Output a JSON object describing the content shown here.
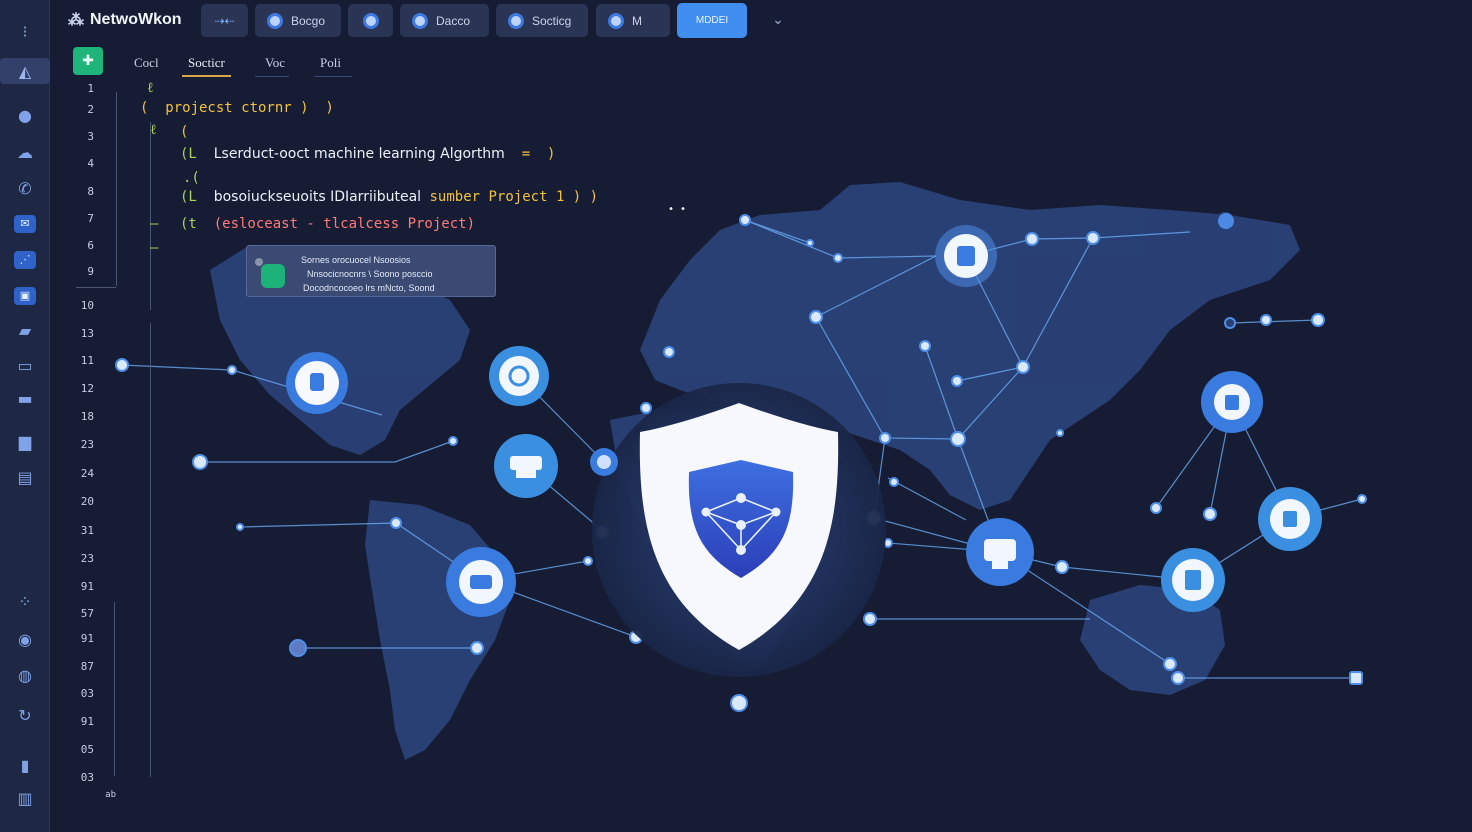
{
  "app": {
    "title": "NetwoWkon",
    "colors": {
      "background": "#161c33",
      "accent": "#3f8ef0",
      "run": "#1fb47a",
      "node": "#3a7be0"
    }
  },
  "toolbar": {
    "chips": [
      {
        "label": "",
        "icon": "arrows-icon"
      },
      {
        "label": "Bocgo",
        "icon": "circle-icon"
      },
      {
        "label": "",
        "icon": "circle-icon"
      },
      {
        "label": "Dacco",
        "icon": "circle-icon"
      },
      {
        "label": "Socticg",
        "icon": "circle-icon"
      },
      {
        "label": "M",
        "icon": "circle-icon"
      }
    ],
    "primary_label": "MDDEI",
    "more_icon": "chevron-down-icon"
  },
  "rail": {
    "icons": [
      "menu-icon",
      "mountain-icon",
      "circle-icon",
      "cloud-icon",
      "phone-icon",
      "mail-icon",
      "chart-icon",
      "square-icon",
      "chat-icon",
      "monitor-icon",
      "message-icon",
      "comment-icon",
      "id-card-icon",
      "dots-icon",
      "globe-icon",
      "compass-icon",
      "refresh-icon",
      "trash-icon",
      "bar-chart-icon"
    ]
  },
  "editor": {
    "run_icon": "play-icon",
    "tabs": [
      "Cocl",
      "Socticr",
      "Voc",
      "Poli"
    ],
    "active_tab": "Socticr",
    "line_numbers": [
      "1",
      "2",
      "3",
      "4",
      "8",
      "7",
      "6",
      "9",
      "10",
      "13",
      "11",
      "12",
      "18",
      "23",
      "24",
      "20",
      "31",
      "23",
      "91",
      "57",
      "91",
      "87",
      "03",
      "91",
      "05",
      "03"
    ],
    "footer_label": "ab",
    "code": {
      "line1": "(  projecst ctornr )  )",
      "line3": "(",
      "line4_prefix": "(L",
      "line4_text": "Lserduct-ooct machine learning Algorthm",
      "line4_suffix": "=  )",
      "line6_prefix": "(L",
      "line6_text": "bosoiuckseuoits IDIarriibuteal",
      "line6_hl": "sumber Project",
      "line6_suffix": "1 ) )",
      "line7_prefix": "(t",
      "line7_text": "(esloceast - tlcalcess Project)"
    },
    "tooltip": {
      "line1": "Sornes orocuocel Nsoosios",
      "line2": "Nnsocicnocnrs \\ Soono posccio",
      "line3": "Docodncocoeo lrs mNcto, Soond"
    }
  },
  "network": {
    "center_node": "shield-network-icon",
    "nodes": [
      {
        "name": "database-node",
        "icon": "cylinder-icon"
      },
      {
        "name": "sync-node",
        "icon": "refresh-icon"
      },
      {
        "name": "server-node",
        "icon": "server-icon"
      },
      {
        "name": "box-node",
        "icon": "package-icon"
      },
      {
        "name": "archive-node",
        "icon": "archive-icon"
      },
      {
        "name": "lock-node",
        "icon": "lock-icon"
      },
      {
        "name": "storage-node",
        "icon": "storage-icon"
      },
      {
        "name": "security-node",
        "icon": "badge-icon"
      },
      {
        "name": "document-node",
        "icon": "document-icon"
      }
    ]
  }
}
